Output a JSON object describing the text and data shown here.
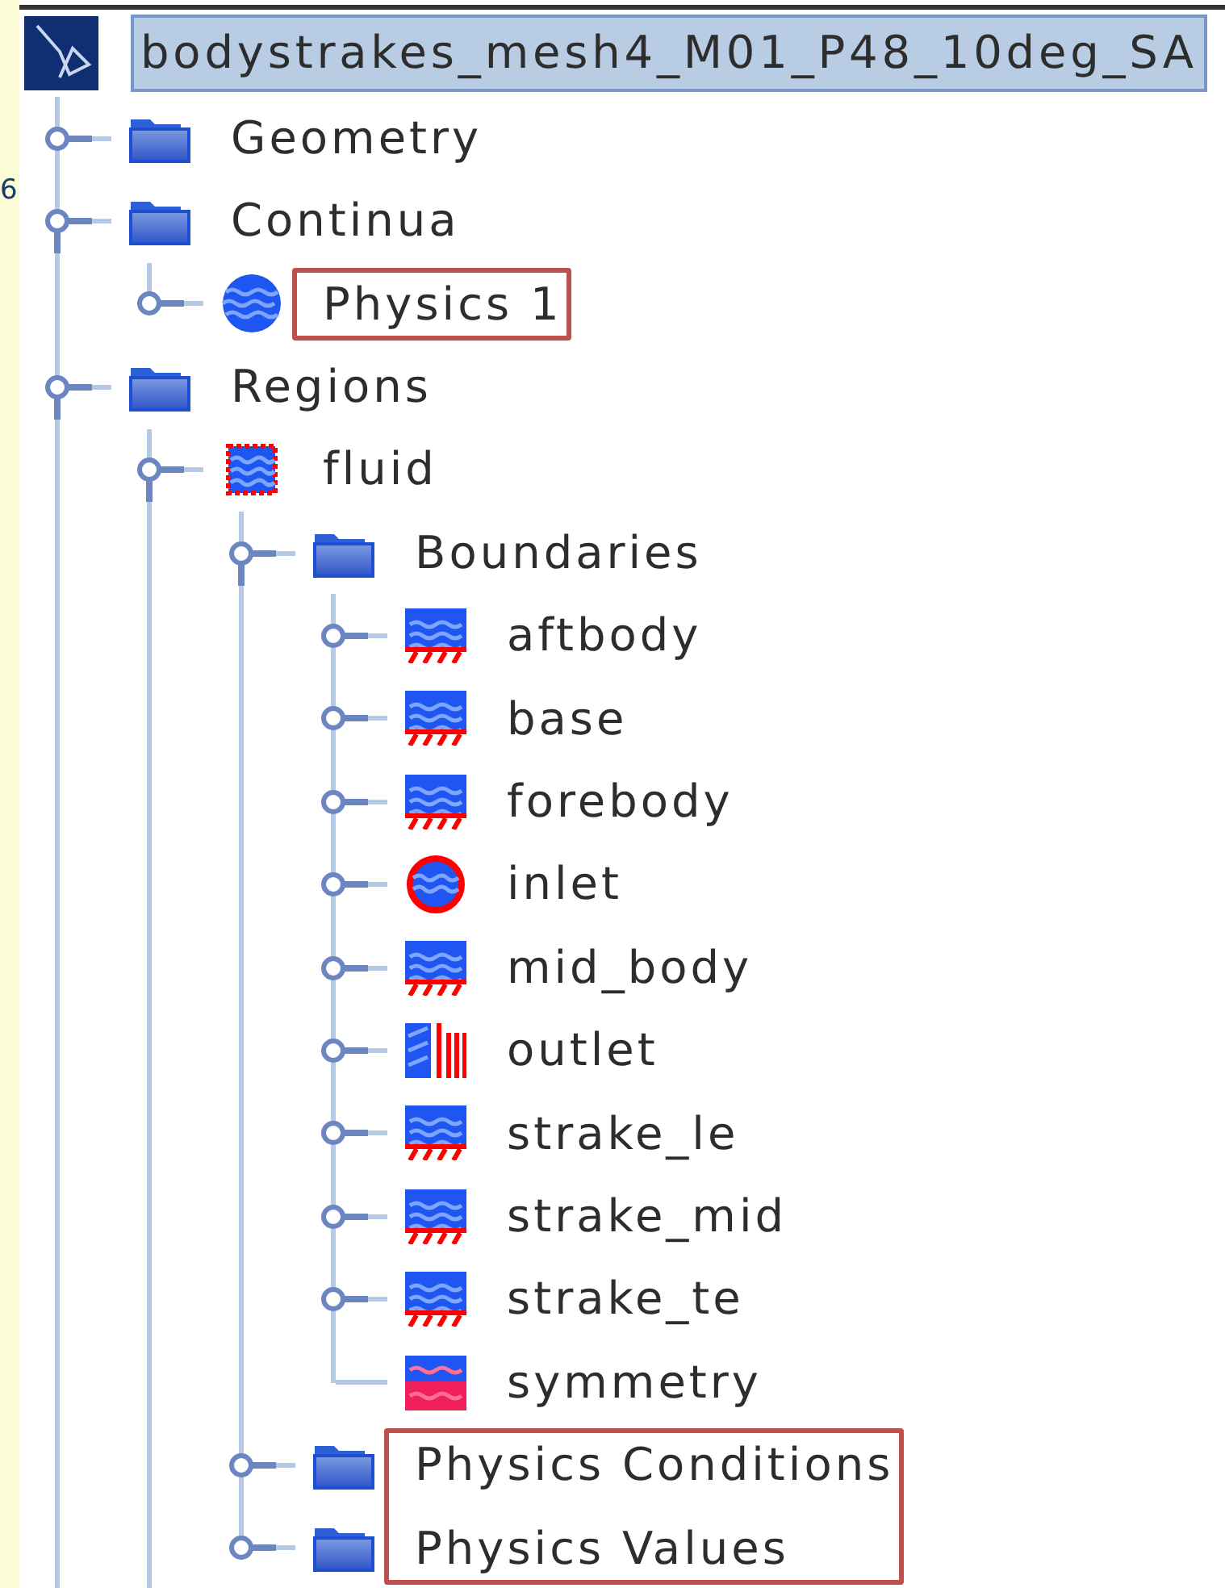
{
  "left_edge_text": "6",
  "tree": {
    "label": "bodystrakes_mesh4_M01_P48_10deg_SA",
    "kind": "logo",
    "selected": true,
    "children": [
      {
        "label": "Geometry",
        "kind": "folder",
        "expanded": false,
        "selected": false,
        "highlighted": false
      },
      {
        "label": "Continua",
        "kind": "folder",
        "expanded": true,
        "selected": false,
        "highlighted": false,
        "children": [
          {
            "label": "Physics 1",
            "kind": "sphere",
            "expanded": false,
            "selected": false,
            "highlighted": true
          }
        ]
      },
      {
        "label": "Regions",
        "kind": "folder",
        "expanded": true,
        "selected": false,
        "highlighted": false,
        "children": [
          {
            "label": "fluid",
            "kind": "region",
            "expanded": true,
            "selected": false,
            "highlighted": false,
            "children": [
              {
                "label": "Boundaries",
                "kind": "folder",
                "expanded": true,
                "selected": false,
                "highlighted": false,
                "children": [
                  {
                    "label": "aftbody",
                    "kind": "wall",
                    "expanded": false,
                    "selected": false,
                    "highlighted": false
                  },
                  {
                    "label": "base",
                    "kind": "wall",
                    "expanded": false,
                    "selected": false,
                    "highlighted": false
                  },
                  {
                    "label": "forebody",
                    "kind": "wall",
                    "expanded": false,
                    "selected": false,
                    "highlighted": false
                  },
                  {
                    "label": "inlet",
                    "kind": "inlet",
                    "expanded": false,
                    "selected": false,
                    "highlighted": false
                  },
                  {
                    "label": "mid_body",
                    "kind": "wall",
                    "expanded": false,
                    "selected": false,
                    "highlighted": false
                  },
                  {
                    "label": "outlet",
                    "kind": "outlet",
                    "expanded": false,
                    "selected": false,
                    "highlighted": false
                  },
                  {
                    "label": "strake_le",
                    "kind": "wall",
                    "expanded": false,
                    "selected": false,
                    "highlighted": false
                  },
                  {
                    "label": "strake_mid",
                    "kind": "wall",
                    "expanded": false,
                    "selected": false,
                    "highlighted": false
                  },
                  {
                    "label": "strake_te",
                    "kind": "wall",
                    "expanded": false,
                    "selected": false,
                    "highlighted": false
                  },
                  {
                    "label": "symmetry",
                    "kind": "symmetry",
                    "selected": false,
                    "highlighted": false
                  }
                ]
              },
              {
                "label": "Physics Conditions",
                "kind": "folder",
                "expanded": false,
                "selected": false,
                "highlighted": true
              },
              {
                "label": "Physics Values",
                "kind": "folder",
                "expanded": false,
                "selected": false,
                "highlighted": true
              }
            ]
          }
        ]
      }
    ]
  }
}
